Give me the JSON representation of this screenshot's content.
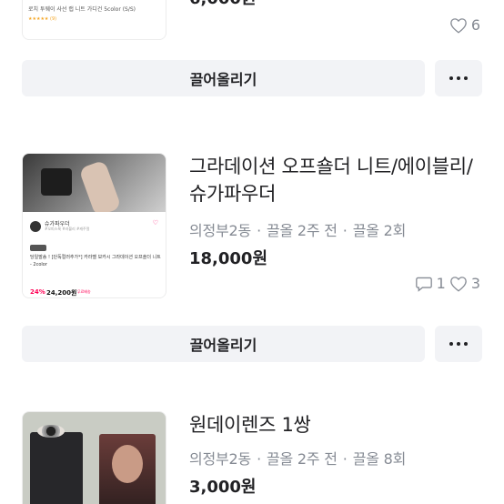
{
  "listings": [
    {
      "thumb_caption": "로치 투웨이 사선 랩 니트 가디건 5color (S/S)",
      "thumb_rating": "★★★★★ (9)",
      "price": "6,000원",
      "like_count": "6",
      "bump_label": "끌어올리기"
    },
    {
      "title": "그라데이션 오프숄더 니트/에이블리/슈가파우더",
      "location": "의정부2동",
      "time": "끌올 2주 전",
      "bump_count": "끌올 2회",
      "price": "18,000원",
      "chat_count": "1",
      "like_count": "3",
      "bump_label": "끌어올리기",
      "thumb_shop_name": "슈가파우더",
      "thumb_shop_sub": "#오피스룩 #러블리 #캐주얼",
      "thumb_desc": "당일발송 ! [단독컬러추가*] 카라멜 보카시 그라데이션 오프숄더 니트 - 2color",
      "thumb_discount": "24%",
      "thumb_price": "24,200원",
      "thumb_badge": "무료배송"
    },
    {
      "title": "원데이렌즈 1쌍",
      "location": "의정부2동",
      "time": "끌올 2주 전",
      "bump_count": "끌올 8회",
      "price": "3,000원"
    }
  ],
  "icons": {
    "heart": "heart-icon",
    "chat": "chat-icon",
    "more": "more-dots-icon"
  }
}
